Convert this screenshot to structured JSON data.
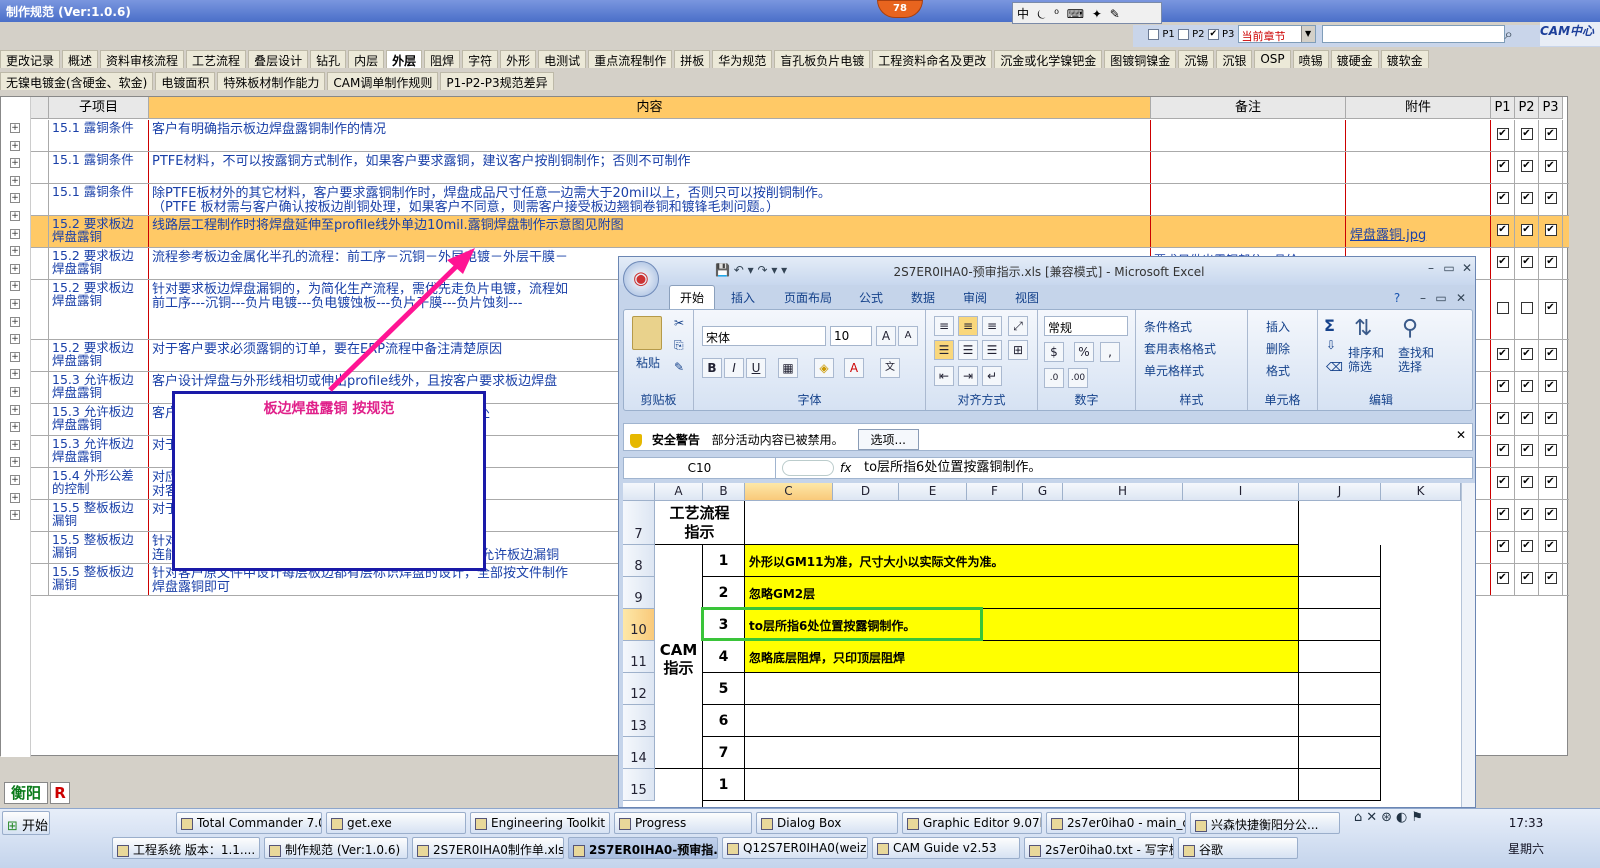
{
  "app": {
    "title": "制作规范 (Ver:1.0.6)",
    "badge": "78"
  },
  "ime": {
    "text": "中 ⏾ ⁰ ⌨ ✦ ✎"
  },
  "filters": {
    "p1": "P1",
    "p2": "P2",
    "p3": "P3",
    "chapter": "当前章节",
    "search_value": "",
    "logo": "CAM中心"
  },
  "nav_row1": [
    "更改记录",
    "概述",
    "资料审核流程",
    "工艺流程",
    "叠层设计",
    "钻孔",
    "内层",
    "外层",
    "阻焊",
    "字符",
    "外形",
    "电测试",
    "重点流程制作",
    "拼板",
    "华为规范",
    "盲孔板负片电镀",
    "工程资料命名及更改",
    "沉金或化学镍钯金",
    "图镀铜镍金",
    "沉锡",
    "沉银",
    "OSP",
    "喷锡",
    "镀硬金",
    "镀软金"
  ],
  "nav_row2": [
    "无镍电镀金(含硬金、软金)",
    "电镀面积",
    "特殊板材制作能力",
    "CAM调单制作规则",
    "P1-P2-P3规范差异"
  ],
  "nav_active": "外层",
  "grid": {
    "headers": {
      "item": "子项目",
      "content": "内容",
      "remark": "备注",
      "attach": "附件",
      "p1": "P1",
      "p2": "P2",
      "p3": "P3"
    },
    "rows": [
      {
        "item": "15.1 露铜条件",
        "content": "客户有明确指示板边焊盘露铜制作的情况",
        "remark": "",
        "attach": "",
        "p1": "✔",
        "p2": "✔",
        "p3": "✔"
      },
      {
        "item": "15.1 露铜条件",
        "content": "PTFE材料，不可以按露铜方式制作，如果客户要求露铜，建议客户按削铜制作；否则不可制作",
        "remark": "",
        "attach": "",
        "p1": "✔",
        "p2": "✔",
        "p3": "✔"
      },
      {
        "item": "15.1 露铜条件",
        "content": "除PTFE板材外的其它材料，客户要求露铜制作时，焊盘成品尺寸任意一边需大于20mil以上，否则只可以按削铜制作。\n（PTFE 板材需与客户确认按板边削铜处理，如果客户不同意，则需客户接受板边翘铜卷铜和镀锋毛刺问题。）",
        "remark": "",
        "attach": "",
        "p1": "✔",
        "p2": "✔",
        "p3": "✔"
      },
      {
        "item": "15.2 要求板边焊盘露铜",
        "content": "线路层工程制作时将焊盘延伸至profile线外单边10mil.露铜焊盘制作示意图见附图",
        "remark": "",
        "attach": "焊盘露铜.jpg",
        "p1": "✔",
        "p2": "✔",
        "p3": "✔"
      },
      {
        "item": "15.2 要求板边焊盘露铜",
        "content": "流程参考板边金属化半孔的流程：前工序－沉铜－外层电镀－外层干膜－",
        "remark": "要求只做出露铜部分，且给",
        "attach": "",
        "p1": "✔",
        "p2": "✔",
        "p3": "✔"
      },
      {
        "item": "15.2 要求板边焊盘露铜",
        "content": "针对要求板边焊盘漏铜的，为简化生产流程，需优先走负片电镀，流程如\n前工序---沉铜---负片电镀---负电镀蚀板---负片干膜---负片蚀刻---",
        "remark": "",
        "attach": "",
        "p1": "",
        "p2": "",
        "p3": "✔"
      },
      {
        "item": "15.2 要求板边焊盘露铜",
        "content": "对于客户要求必须露铜的订单，要在ERP流程中备注清楚原因",
        "remark": "",
        "attach": "",
        "p1": "✔",
        "p2": "✔",
        "p3": "✔"
      },
      {
        "item": "15.3 允许板边焊盘露铜",
        "content": "客户设计焊盘与外形线相切或伸出profile线外，且按客户要求板边焊盘",
        "remark": "",
        "attach": "",
        "p1": "✔",
        "p2": "✔",
        "p3": "✔"
      },
      {
        "item": "15.3 允许板边焊盘露铜",
        "content": "客户允许板边焊盘露铜时，按客户要求计制作，不做削铜处",
        "remark": "",
        "attach": "",
        "p1": "✔",
        "p2": "✔",
        "p3": "✔"
      },
      {
        "item": "15.3 允许板边焊盘露铜",
        "content": "对于客户允许露铜的订单，要在ERP中注明原因",
        "remark": "",
        "attach": "",
        "p1": "✔",
        "p2": "✔",
        "p3": "✔"
      },
      {
        "item": "15.4 外形公差的控制",
        "content": "对应客户的外形公差，按客户外形伸出外形中心线10\n对客户设计外形需要10MIL制作.；同时在",
        "remark": "",
        "attach": "",
        "p1": "✔",
        "p2": "✔",
        "p3": "✔"
      },
      {
        "item": "15.5 整板板边漏铜",
        "content": "对于客户设计整板板边漏铜时，外形注明采用新铣刀铣",
        "remark": "",
        "attach": "",
        "p1": "✔",
        "p2": "✔",
        "p3": "✔"
      },
      {
        "item": "15.5 整板板边漏铜",
        "content": "针对客户设计连接位时桥连的宽度需要按\n连能力的需添加桥连后制作，外形时再铣出。 铣板处备注允许板边漏铜",
        "remark": "",
        "attach": "",
        "p1": "✔",
        "p2": "✔",
        "p3": "✔"
      },
      {
        "item": "15.5 整板板边漏铜",
        "content": "针对客户原文件中设计每层板边都有层标识焊盘的设计，全部按文件制作\n焊盘露铜即可",
        "remark": "",
        "attach": "",
        "p1": "✔",
        "p2": "✔",
        "p3": "✔"
      }
    ]
  },
  "bottom": {
    "city": "衡阳",
    "r": "R"
  },
  "annotation": {
    "text": "板边焊盘露铜    按规范"
  },
  "excel": {
    "title": "2S7ER0IHA0-预审指示.xls  [兼容模式] - Microsoft Excel",
    "qat": "💾 ↶ ▾ ↷ ▾ ▾",
    "tabs": [
      "开始",
      "插入",
      "页面布局",
      "公式",
      "数据",
      "审阅",
      "视图"
    ],
    "groups": {
      "clipboard": "剪贴板",
      "font": "字体",
      "align": "对齐方式",
      "number": "数字",
      "style": "样式",
      "cells": "单元格",
      "edit": "编辑"
    },
    "paste": "粘贴",
    "font_name": "宋体",
    "font_size": "10",
    "number_format": "常规",
    "style_items": [
      "条件格式",
      "套用表格格式",
      "单元格样式"
    ],
    "cell_items": [
      "插入",
      "删除",
      "格式"
    ],
    "sort_label": "排序和\n筛选",
    "find_label": "查找和\n选择",
    "security": {
      "title": "安全警告",
      "msg": "部分活动内容已被禁用。",
      "btn": "选项..."
    },
    "namebox": "C10",
    "fx": "fx",
    "formula": "to层所指6处位置按露铜制作。",
    "cols": [
      "A",
      "B",
      "C",
      "D",
      "E",
      "F",
      "G",
      "H",
      "I",
      "J",
      "K"
    ],
    "rownums": [
      "7",
      "8",
      "9",
      "10",
      "11",
      "12",
      "13",
      "14",
      "15"
    ],
    "header_cell": "工艺流程\n指示",
    "cam_label": "CAM\n指示",
    "items": [
      {
        "n": "1",
        "text": "外形以GM11为准，尺寸大小以实际文件为准。"
      },
      {
        "n": "2",
        "text": "忽略GM2层"
      },
      {
        "n": "3",
        "text": "to层所指6处位置按露铜制作。"
      },
      {
        "n": "4",
        "text": "忽略底层阻焊，只印顶层阻焊"
      },
      {
        "n": "5",
        "text": ""
      },
      {
        "n": "6",
        "text": ""
      },
      {
        "n": "7",
        "text": ""
      },
      {
        "n": "1",
        "text": ""
      }
    ]
  },
  "taskbar": {
    "start": "开始",
    "row1": [
      "Total Commander 7.0 ...",
      "get.exe",
      "Engineering Toolkit 9....",
      "Progress",
      "Dialog Box",
      "Graphic Editor 9.07b2...",
      "2s7er0iha0 - main_qa",
      "兴森快捷衡阳分公..."
    ],
    "row2": [
      "工程系统  版本：1.1....",
      "制作规范 (Ver:1.0.6)",
      "2S7ER0IHA0制作单.xls...",
      "2S7ER0IHA0-预审指...",
      "Q12S7ER0IHA0(weizy)...",
      "CAM Guide v2.53",
      "2s7er0iha0.txt - 写字板",
      "谷歌"
    ],
    "time": "17:33",
    "day": "星期六"
  }
}
